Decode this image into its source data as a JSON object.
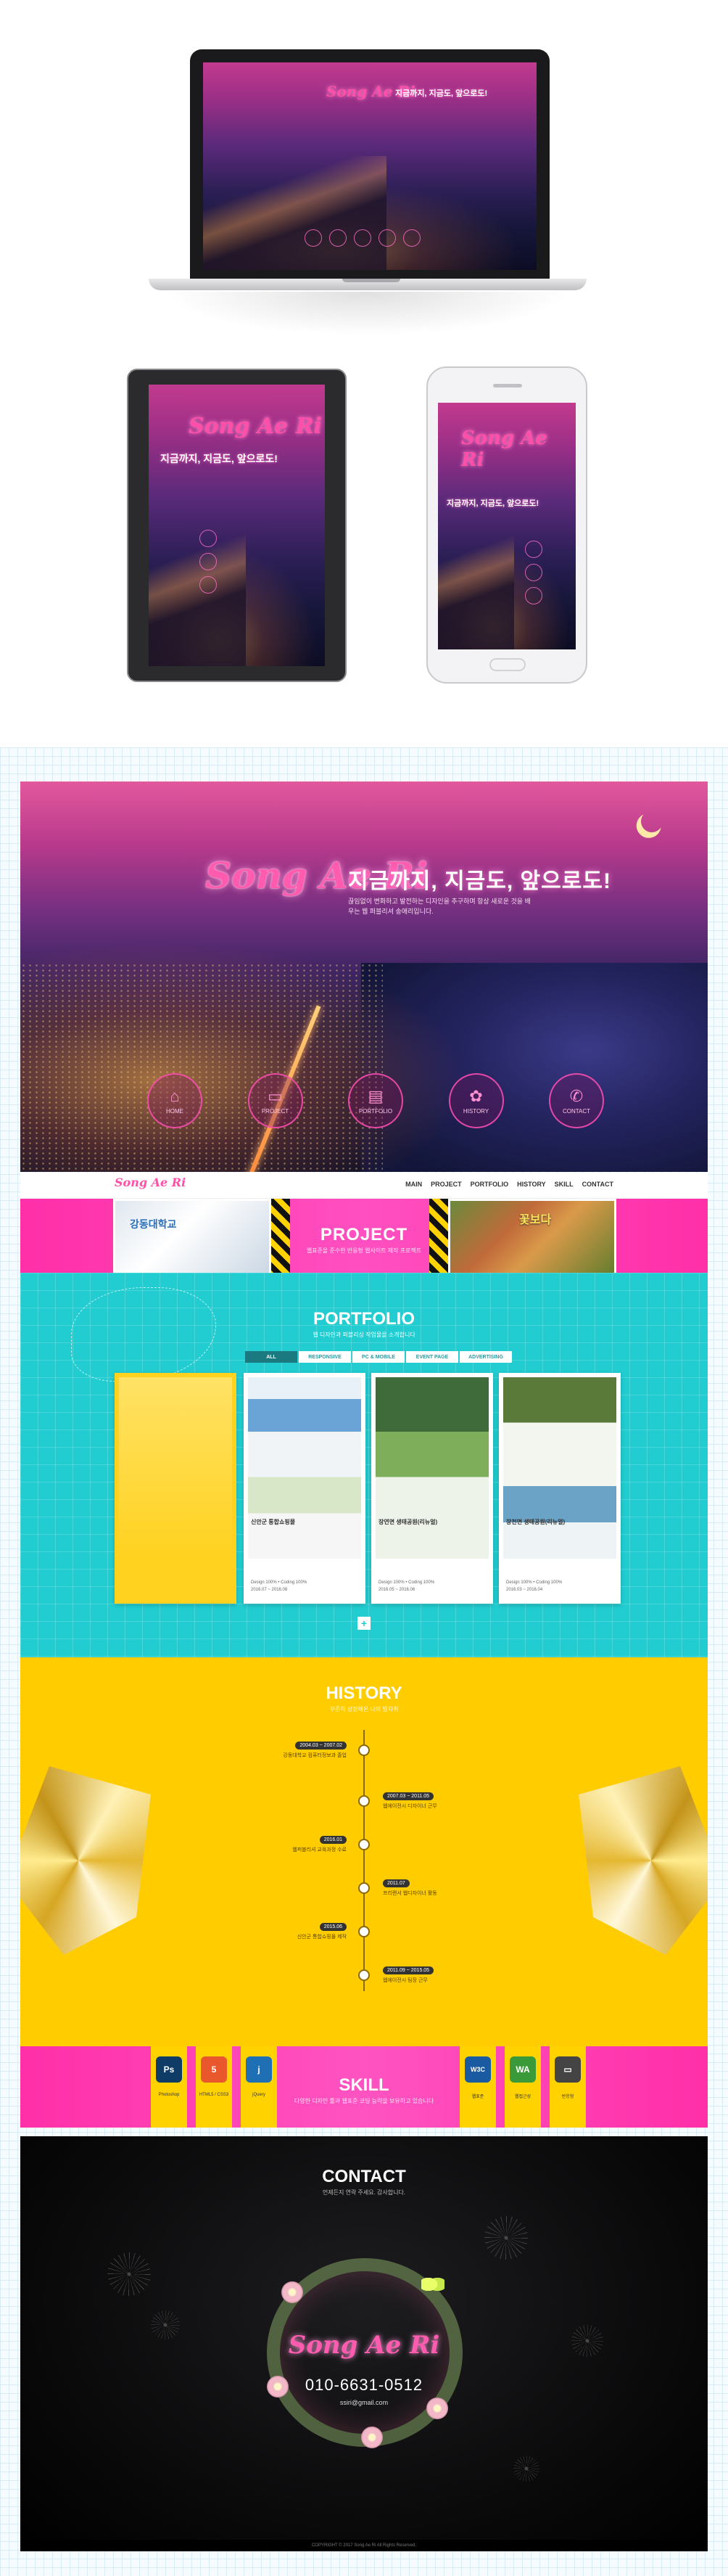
{
  "mockups": {
    "tagline": "지금까지, 지금도, 앞으로도!",
    "logo": "Song Ae Ri"
  },
  "hero": {
    "logo": "Song Ae Ri",
    "tagline": "지금까지, 지금도, 앞으로도!",
    "intro": "끊임없이 변화하고 발전하는 디자인을 추구하며 항상 새로운 것을 배우는 웹 퍼블리셔 송애리입니다.",
    "icons": [
      {
        "icon": "home-icon",
        "glyph": "⌂",
        "label": "HOME"
      },
      {
        "icon": "monitor-icon",
        "glyph": "▭",
        "label": "PROJECT"
      },
      {
        "icon": "file-icon",
        "glyph": "▤",
        "label": "PORTFOLIO"
      },
      {
        "icon": "flower-icon",
        "glyph": "✿",
        "label": "HISTORY"
      },
      {
        "icon": "phone-icon",
        "glyph": "✆",
        "label": "CONTACT"
      }
    ]
  },
  "nav": {
    "brand": "Song Ae Ri",
    "items": [
      "MAIN",
      "PROJECT",
      "PORTFOLIO",
      "HISTORY",
      "SKILL",
      "CONTACT"
    ]
  },
  "project": {
    "title": "PROJECT",
    "subtitle": "웹표준을 준수한 반응형 웹사이트 제작 프로젝트",
    "left_caption": "강동대학교",
    "right_caption": "꽃보다 "
  },
  "portfolio": {
    "title": "PORTFOLIO",
    "subtitle": "웹 디자인과 퍼블리싱 작업물을 소개합니다",
    "tabs": [
      "ALL",
      "RESPONSIVE",
      "PC & MOBILE",
      "EVENT PAGE",
      "ADVERTISING"
    ],
    "cards": [
      {
        "name": "",
        "meta1": "",
        "meta2": ""
      },
      {
        "name": "신안군 통합쇼핑몰",
        "meta1": "Design 100% • Coding 100%",
        "meta2": "2016.07 ~ 2016.08"
      },
      {
        "name": "장연면 생태공원(리뉴얼)",
        "meta1": "Design 100% • Coding 100%",
        "meta2": "2016.05 ~ 2016.06"
      },
      {
        "name": "장천면 생태공원(리뉴얼)",
        "meta1": "Design 100% • Coding 100%",
        "meta2": "2016.03 ~ 2016.04"
      }
    ],
    "more": "+"
  },
  "history": {
    "title": "HISTORY",
    "subtitle": "꾸준히 성장해온 나의 발자취",
    "items": [
      {
        "period": "2004.03 ~ 2007.02",
        "text": "강동대학교 컴퓨터정보과 졸업"
      },
      {
        "period": "2007.03 ~ 2011.05",
        "text": "웹에이전시 디자이너 근무"
      },
      {
        "period": "2016.01",
        "text": "웹퍼블리셔 교육과정 수료"
      },
      {
        "period": "2011.07",
        "text": "프리랜서 웹디자이너 활동"
      },
      {
        "period": "2015.06",
        "text": "신안군 통합쇼핑몰 제작"
      },
      {
        "period": "2011.09 ~ 2015.05",
        "text": "웹에이전시 팀장 근무"
      }
    ]
  },
  "skill": {
    "title": "SKILL",
    "subtitle": "다양한 디자인 툴과 웹표준 코딩 능력을 보유하고 있습니다",
    "left": [
      {
        "icon": "photoshop-icon",
        "glyph": "Ps",
        "color": "#0f3c66",
        "label": "Photoshop"
      },
      {
        "icon": "html5-icon",
        "glyph": "5",
        "color": "#e8582c",
        "label": "HTML5 / CSS3"
      },
      {
        "icon": "jquery-icon",
        "glyph": "j",
        "color": "#1f6fb5",
        "label": "jQuery"
      }
    ],
    "right": [
      {
        "icon": "w3c-icon",
        "glyph": "W3C",
        "color": "#1a5aa0",
        "label": "웹표준"
      },
      {
        "icon": "wa-icon",
        "glyph": "WA",
        "color": "#3a9a3a",
        "label": "웹접근성"
      },
      {
        "icon": "monitor-icon",
        "glyph": "▭",
        "color": "#444444",
        "label": "반응형"
      }
    ]
  },
  "contact": {
    "title": "CONTACT",
    "subtitle": "언제든지 연락 주세요. 감사합니다.",
    "logo": "Song Ae Ri",
    "phone": "010-6631-0512",
    "email": "ssiri@gmail.com"
  },
  "footer": {
    "copyright": "COPYRIGHT © 2017 Song Ae Ri All Rights Reserved."
  }
}
